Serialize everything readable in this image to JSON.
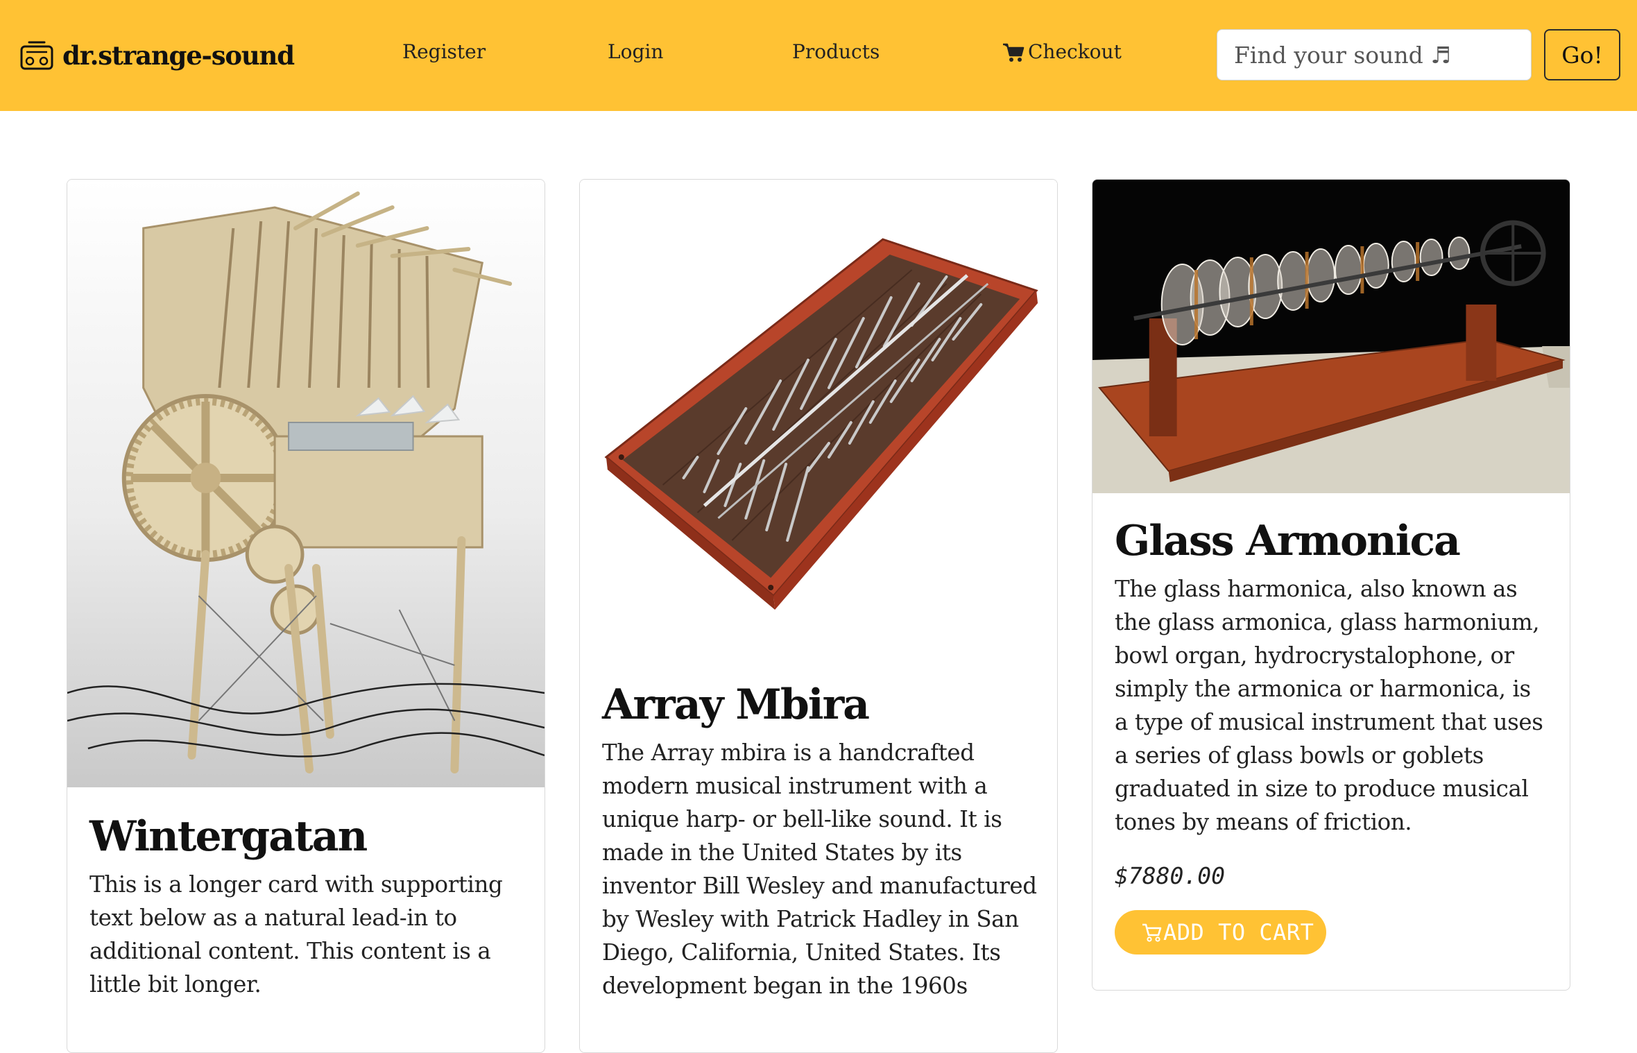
{
  "navbar": {
    "brand": "dr.strange-sound",
    "links": {
      "register": "Register",
      "login": "Login",
      "products": "Products",
      "checkout": "Checkout"
    },
    "search": {
      "placeholder": "Find your sound ♬"
    },
    "go_label": "Go!"
  },
  "products": [
    {
      "name": "Wintergatan",
      "description": "This is a longer card with supporting text below as a natural lead-in to additional content. This content is a little bit longer."
    },
    {
      "name": "Array Mbira",
      "description": "The Array mbira is a handcrafted modern musical instrument with a unique harp- or bell-like sound. It is made in the United States by its inventor Bill Wesley and manufactured by Wesley with Patrick Hadley in San Diego, California, United States. Its development began in the 1960s"
    },
    {
      "name": "Glass Armonica",
      "description": "The glass harmonica, also known as the glass armonica, glass harmonium, bowl organ, hydrocrystalophone, or simply the armonica or harmonica, is a type of musical instrument that uses a series of glass bowls or goblets graduated in size to produce musical tones by means of friction.",
      "price": "$7880.00",
      "button": "ADD TO CART"
    }
  ],
  "colors": {
    "navbar": "#ffc234",
    "accent": "#ffc234",
    "text": "#212529"
  },
  "icons": {
    "brand": "radio-icon",
    "checkout": "cart-icon",
    "add_to_cart": "cart-icon"
  }
}
